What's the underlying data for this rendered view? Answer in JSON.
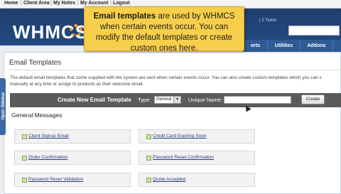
{
  "topnav": [
    "Home",
    "Client Area",
    "My Notes",
    "My Account",
    "Logout"
  ],
  "header": {
    "logo": "WHMCS",
    "right_text": "| 2 Ticket",
    "nav_tabs": [
      "orts",
      "Utilities",
      "Addons"
    ]
  },
  "callout": {
    "bold": "Email templates",
    "text": " are used by WHMCS when certain events occur. You can modify the default templates or create custom ones here."
  },
  "sidebar": {
    "label": "Open Sidebar"
  },
  "page": {
    "title": "Email Templates",
    "intro_line1": "The default email templates that come supplied with the system are sent when certain events occur. You can also create custom templates which you can s",
    "intro_line2": "manually at any time or assign to products as their welcome email."
  },
  "create_bar": {
    "title": "Create New Email Template",
    "type_label": "Type:",
    "type_value": "General",
    "unique_name_label": "Unique Name:",
    "unique_name_value": "",
    "create_button": "Create"
  },
  "sections": {
    "general_title": "General Messages",
    "templates": [
      "Client Signup Email",
      "Credit Card Expiring Soon",
      "Order Confirmation",
      "Password Reset Confirmation",
      "Password Reset Validation",
      "Quote Accepted"
    ]
  }
}
